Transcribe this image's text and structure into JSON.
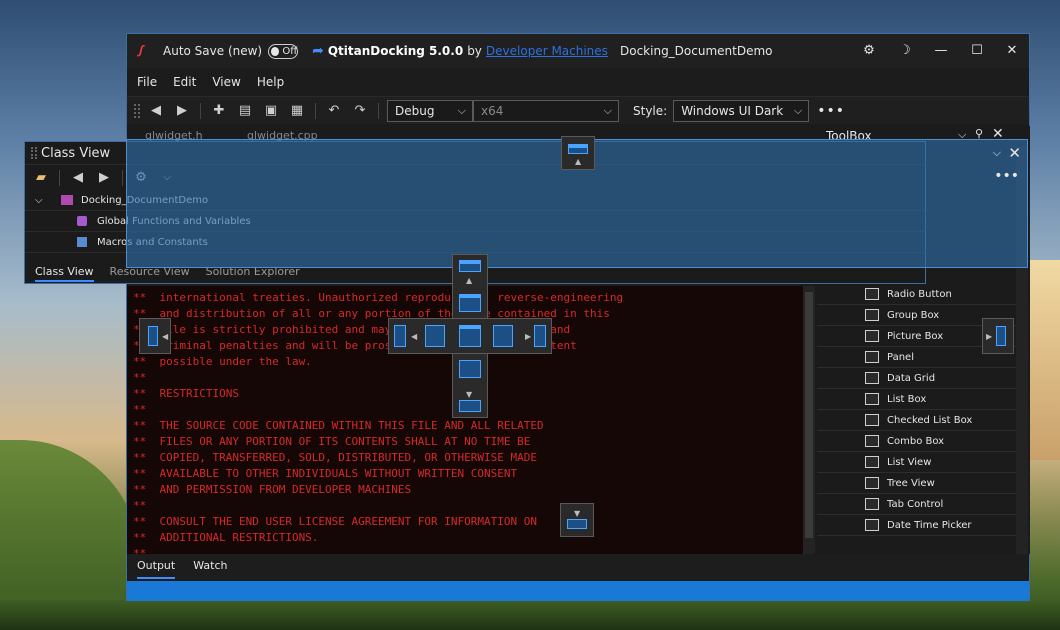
{
  "window": {
    "autosave_label": "Auto Save (new)",
    "autosave_state": "Off",
    "product": "QtitanDocking 5.0.0",
    "by": "by",
    "vendor_link": "Developer Machines",
    "doc_title": "Docking_DocumentDemo"
  },
  "menu": [
    "File",
    "Edit",
    "View",
    "Help"
  ],
  "toolbar": {
    "config_value": "Debug",
    "platform_value": "x64",
    "style_label": "Style:",
    "style_value": "Windows UI Dark",
    "more": "•••"
  },
  "doc_tabs": [
    "qlwidget.h",
    "qlwidget.cpp"
  ],
  "class_view": {
    "title": "Class View",
    "tree": [
      {
        "label": "Docking_DocumentDemo"
      },
      {
        "label": "Global Functions and Variables"
      },
      {
        "label": "Macros and Constants"
      }
    ],
    "tabs": [
      "Class View",
      "Resource View",
      "Solution Explorer"
    ]
  },
  "editor": {
    "lines": [
      "**  international treaties. Unauthorized reproduction, reverse-engineering",
      "**  and distribution of all or any portion of the code contained in this",
      "**  file is strictly prohibited and may result in severe civil and",
      "**  criminal penalties and will be prosecuted to the maximum extent",
      "**  possible under the law.",
      "**",
      "**  RESTRICTIONS",
      "**",
      "**  THE SOURCE CODE CONTAINED WITHIN THIS FILE AND ALL RELATED",
      "**  FILES OR ANY PORTION OF ITS CONTENTS SHALL AT NO TIME BE",
      "**  COPIED, TRANSFERRED, SOLD, DISTRIBUTED, OR OTHERWISE MADE",
      "**  AVAILABLE TO OTHER INDIVIDUALS WITHOUT WRITTEN CONSENT",
      "**  AND PERMISSION FROM DEVELOPER MACHINES",
      "**",
      "**  CONSULT THE END USER LICENSE AGREEMENT FOR INFORMATION ON",
      "**  ADDITIONAL RESTRICTIONS.",
      "**"
    ]
  },
  "toolbox": {
    "title": "ToolBox",
    "items": [
      "Radio Button",
      "Group Box",
      "Picture Box",
      "Panel",
      "Data Grid",
      "List Box",
      "Checked List Box",
      "Combo Box",
      "List View",
      "Tree View",
      "Tab Control",
      "Date Time Picker"
    ]
  },
  "bottom_tabs": [
    "Output",
    "Watch"
  ],
  "colors": {
    "accent": "#1a78d6",
    "code": "#d42a2a",
    "dock_preview": "#2e6eaa"
  }
}
